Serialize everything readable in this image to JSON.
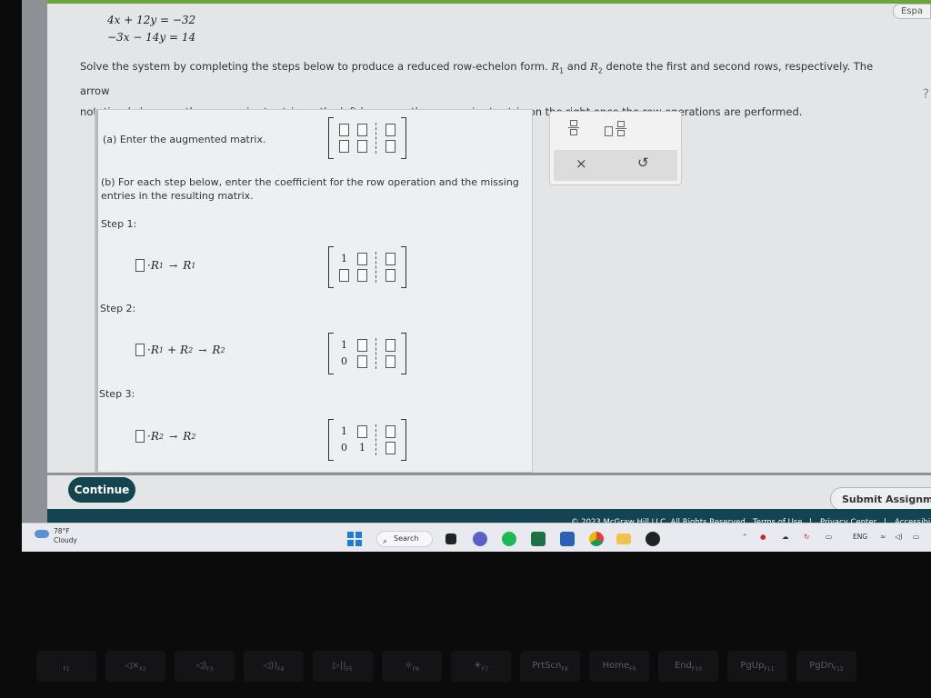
{
  "problem": {
    "equations": [
      "4x + 12y = −32",
      "−3x − 14y = 14"
    ],
    "instructions_line1_a": "Solve the system by completing the steps below to produce a reduced row-echelon form.",
    "instructions_r1": "R",
    "instructions_r1_sub": "1",
    "instructions_and": "and",
    "instructions_r2": "R",
    "instructions_r2_sub": "2",
    "instructions_line1_b": "denote the first and second rows, respectively. The arrow",
    "instructions_line2": "notation (→) means the expression/matrix on the left becomes the expression/matrix on the right once the row operations are performed."
  },
  "part_a": {
    "label": "(a) Enter the augmented matrix.",
    "matrix": [
      [
        "□",
        "□",
        "□"
      ],
      [
        "□",
        "□",
        "□"
      ]
    ]
  },
  "part_b": {
    "label_line1": "(b) For each step below, enter the coefficient for the row operation and the missing",
    "label_line2": "entries in the resulting matrix."
  },
  "steps": [
    {
      "label": "Step 1:",
      "op": {
        "term1": "R",
        "term1_sub": "1",
        "plus": "",
        "term2": "",
        "term2_sub": "",
        "target": "R",
        "target_sub": "1"
      },
      "matrix": [
        [
          "1",
          "□",
          "□"
        ],
        [
          "□",
          "□",
          "□"
        ]
      ]
    },
    {
      "label": "Step 2:",
      "op": {
        "term1": "R",
        "term1_sub": "1",
        "plus": "+",
        "term2": "R",
        "term2_sub": "2",
        "target": "R",
        "target_sub": "2"
      },
      "matrix": [
        [
          "1",
          "□",
          "□"
        ],
        [
          "0",
          "□",
          "□"
        ]
      ]
    },
    {
      "label": "Step 3:",
      "op": {
        "term1": "R",
        "term1_sub": "2",
        "plus": "",
        "term2": "",
        "term2_sub": "",
        "target": "R",
        "target_sub": "2"
      },
      "matrix": [
        [
          "1",
          "□",
          "□"
        ],
        [
          "0",
          "1",
          "□"
        ]
      ]
    }
  ],
  "arrow": "→",
  "dot": "·",
  "palette": {
    "icons": [
      "fraction-icon",
      "mixed-number-icon",
      "clear-icon",
      "undo-icon"
    ],
    "clear": "×",
    "undo": "↺"
  },
  "buttons": {
    "continue": "Continue",
    "submit": "Submit Assignme",
    "language": "Espa"
  },
  "help": "?",
  "footer": {
    "copyright": "© 2023 McGraw Hill LLC. All Rights Reserved.",
    "terms": "Terms of Use",
    "privacy": "Privacy Center",
    "accessibility": "Accessibi",
    "divider": "|"
  },
  "taskbar": {
    "temperature": "78°F",
    "condition": "Cloudy",
    "search": "Search",
    "language": "ENG",
    "apps": [
      "windows-start-icon",
      "search-icon",
      "file-explorer-icon",
      "chat-icon",
      "spotify-icon",
      "excel-icon",
      "word-icon",
      "chrome-icon",
      "folder-icon",
      "app-icon"
    ]
  },
  "keyboard": {
    "keys": [
      {
        "label": "",
        "sub": "F1"
      },
      {
        "label": "◁×",
        "sub": "F2"
      },
      {
        "label": "◁)",
        "sub": "F3"
      },
      {
        "label": "◁))",
        "sub": "F4"
      },
      {
        "label": "▷||",
        "sub": "F5"
      },
      {
        "label": "☼",
        "sub": "F6"
      },
      {
        "label": "☀",
        "sub": "F7"
      },
      {
        "label": "PrtScn",
        "sub": "F8"
      },
      {
        "label": "Home",
        "sub": "F9"
      },
      {
        "label": "End",
        "sub": "F10"
      },
      {
        "label": "PgUp",
        "sub": "F11"
      },
      {
        "label": "PgDn",
        "sub": "F12"
      }
    ]
  },
  "colors": {
    "accent_green": "#6ca53c",
    "footer_teal": "#124551",
    "continue_teal": "#14454f",
    "spotify_green": "#1db954",
    "excel_green": "#1e7145",
    "word_blue": "#2b5fb8"
  }
}
